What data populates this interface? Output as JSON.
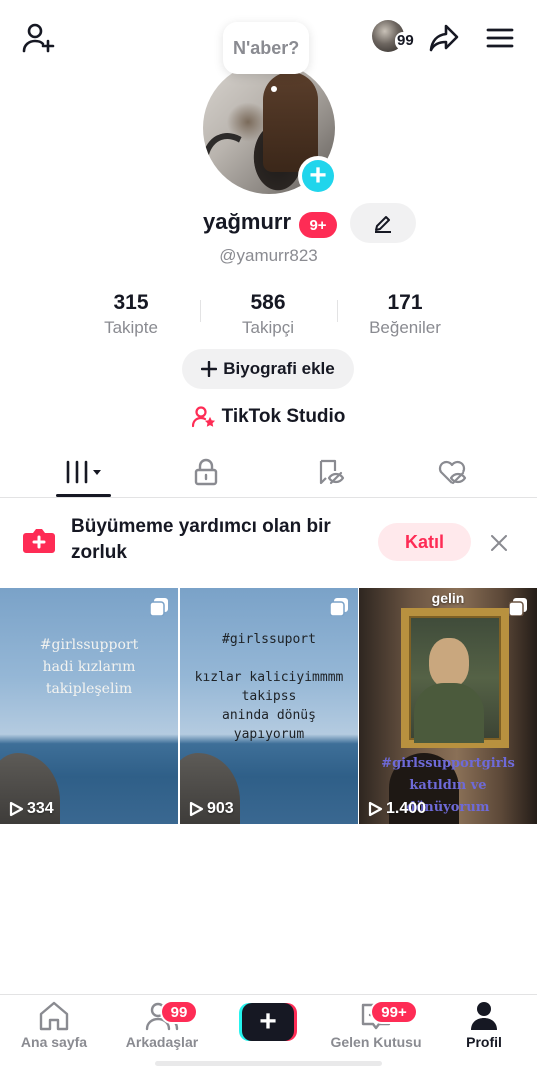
{
  "top_bar": {
    "avatar_badge": "99"
  },
  "profile": {
    "status_bubble": "N'aber?",
    "username": "yağmurr",
    "name_badge": "9+",
    "handle": "@yamurr823"
  },
  "stats": [
    {
      "value": "315",
      "label": "Takipte"
    },
    {
      "value": "586",
      "label": "Takipçi"
    },
    {
      "value": "171",
      "label": "Beğeniler"
    }
  ],
  "actions": {
    "add_bio": "Biyografi ekle",
    "studio": "TikTok Studio"
  },
  "tabs": [
    {
      "icon": "grid-icon",
      "active": true
    },
    {
      "icon": "lock-icon",
      "active": false
    },
    {
      "icon": "repost-icon",
      "active": false
    },
    {
      "icon": "liked-icon",
      "active": false
    }
  ],
  "banner": {
    "text": "Büyümeme yardımcı olan bir zorluk",
    "join_label": "Katıl"
  },
  "videos": [
    {
      "caption": [
        "#girlssupport",
        "hadi kızlarım",
        "takipleşelim"
      ],
      "plays": "334"
    },
    {
      "caption": [
        "#girlssuport",
        "",
        "kızlar kaliciyimmmm",
        "takipss",
        "aninda dönüş",
        "yapıyorum"
      ],
      "plays": "903"
    },
    {
      "top_text": "gelin",
      "caption": [
        "#girlssupportgirls",
        "katıldın ve",
        "dönüyorum"
      ],
      "plays": "1.400"
    }
  ],
  "bottom_nav": {
    "home": "Ana sayfa",
    "friends": "Arkadaşlar",
    "friends_badge": "99",
    "inbox": "Gelen Kutusu",
    "inbox_badge": "99+",
    "profile": "Profil"
  },
  "colors": {
    "accent": "#fe2c55",
    "cyan": "#20d5ec",
    "text": "#161823",
    "muted": "#8a8b91"
  }
}
